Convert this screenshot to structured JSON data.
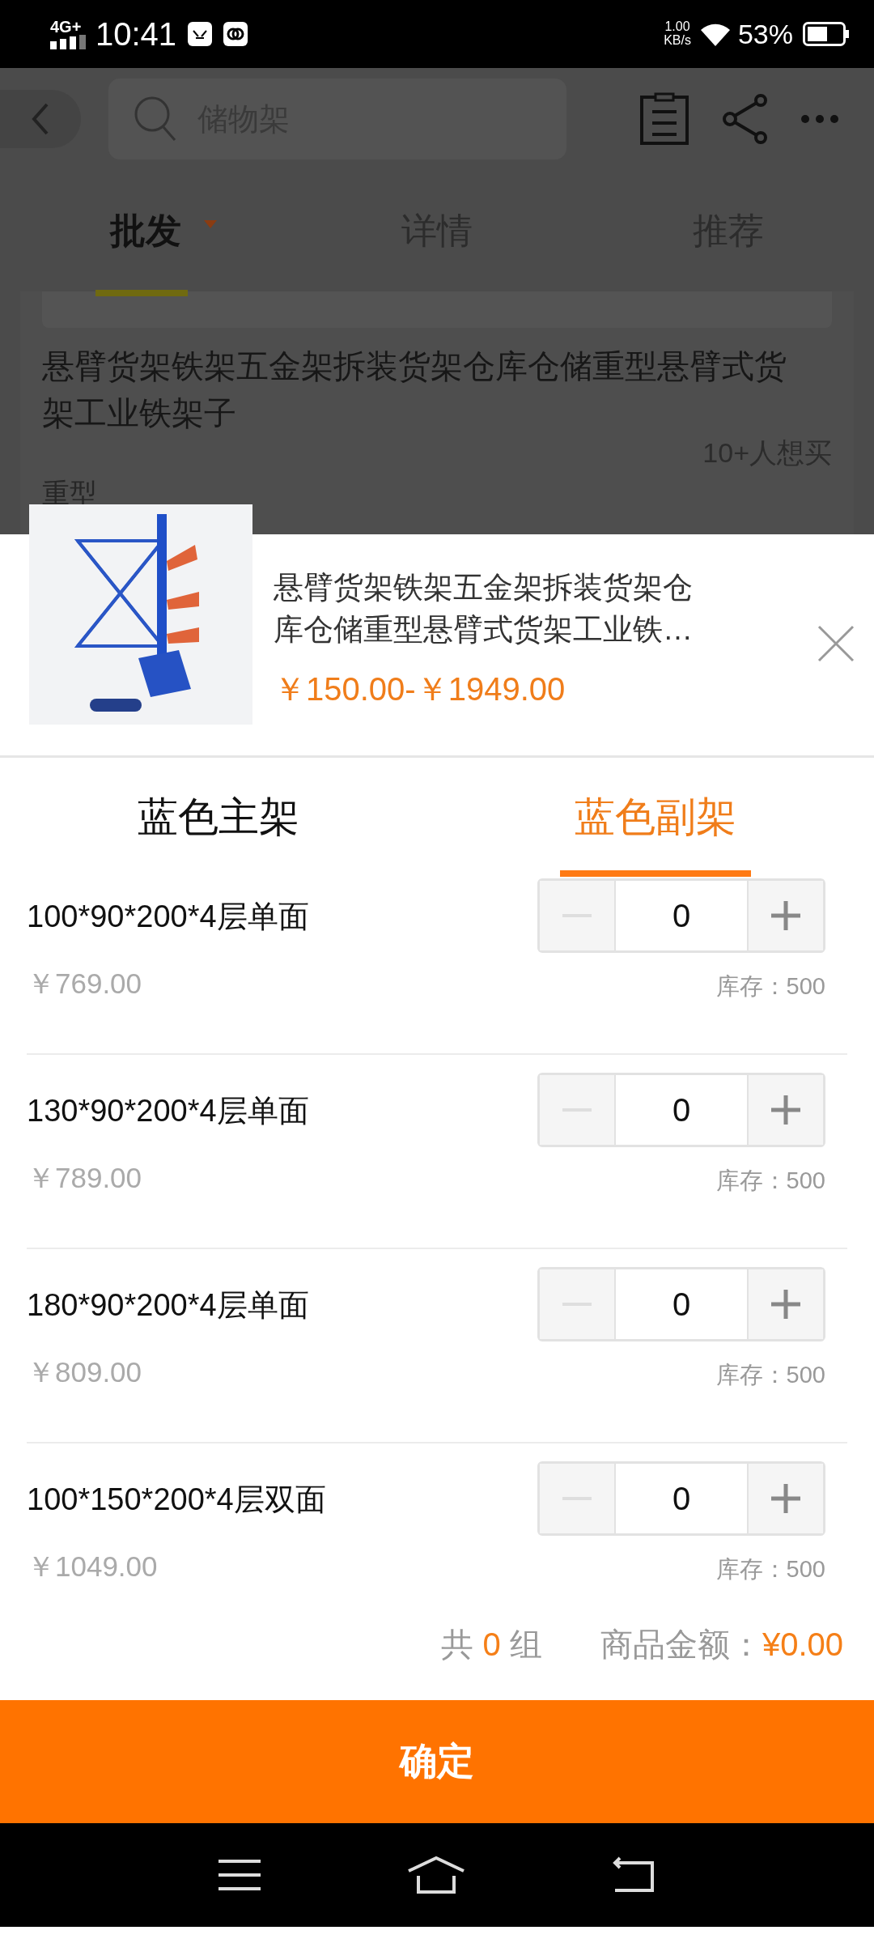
{
  "status_bar": {
    "network": "4G+",
    "time": "10:41",
    "speed_value": "1.00",
    "speed_unit": "KB/s",
    "battery": "53%"
  },
  "header": {
    "search": {
      "placeholder": "储物架"
    }
  },
  "page_tabs": [
    {
      "label": "批发",
      "selected": true,
      "dropdown": true
    },
    {
      "label": "详情",
      "selected": false,
      "dropdown": false
    },
    {
      "label": "推荐",
      "selected": false,
      "dropdown": false
    }
  ],
  "background_product": {
    "title": "悬臂货架铁架五金架拆装货架仓库仓储重型悬臂式货架工业铁架子",
    "wants": "10+人想买",
    "tag": "重型"
  },
  "sheet": {
    "title": "悬臂货架铁架五金架拆装货架仓库仓储重型悬臂式货架工业铁…",
    "price": "￥150.00-￥1949.00",
    "variant_tabs": [
      {
        "label": "蓝色主架",
        "selected": false
      },
      {
        "label": "蓝色副架",
        "selected": true
      }
    ],
    "options": [
      {
        "name": "100*90*200*4层单面",
        "price": "￥769.00",
        "quantity": "0",
        "stock": "库存：500",
        "decrement_disabled": true
      },
      {
        "name": "130*90*200*4层单面",
        "price": "￥789.00",
        "quantity": "0",
        "stock": "库存：500",
        "decrement_disabled": true
      },
      {
        "name": "180*90*200*4层单面",
        "price": "￥809.00",
        "quantity": "0",
        "stock": "库存：500",
        "decrement_disabled": true
      },
      {
        "name": "100*150*200*4层双面",
        "price": "￥1049.00",
        "quantity": "0",
        "stock": "库存：500",
        "decrement_disabled": true
      }
    ],
    "summary": {
      "count_prefix": "共",
      "count": "0",
      "count_suffix": "组",
      "amount_label": "商品金额：",
      "amount": "¥0.00"
    },
    "confirm": "确定"
  }
}
